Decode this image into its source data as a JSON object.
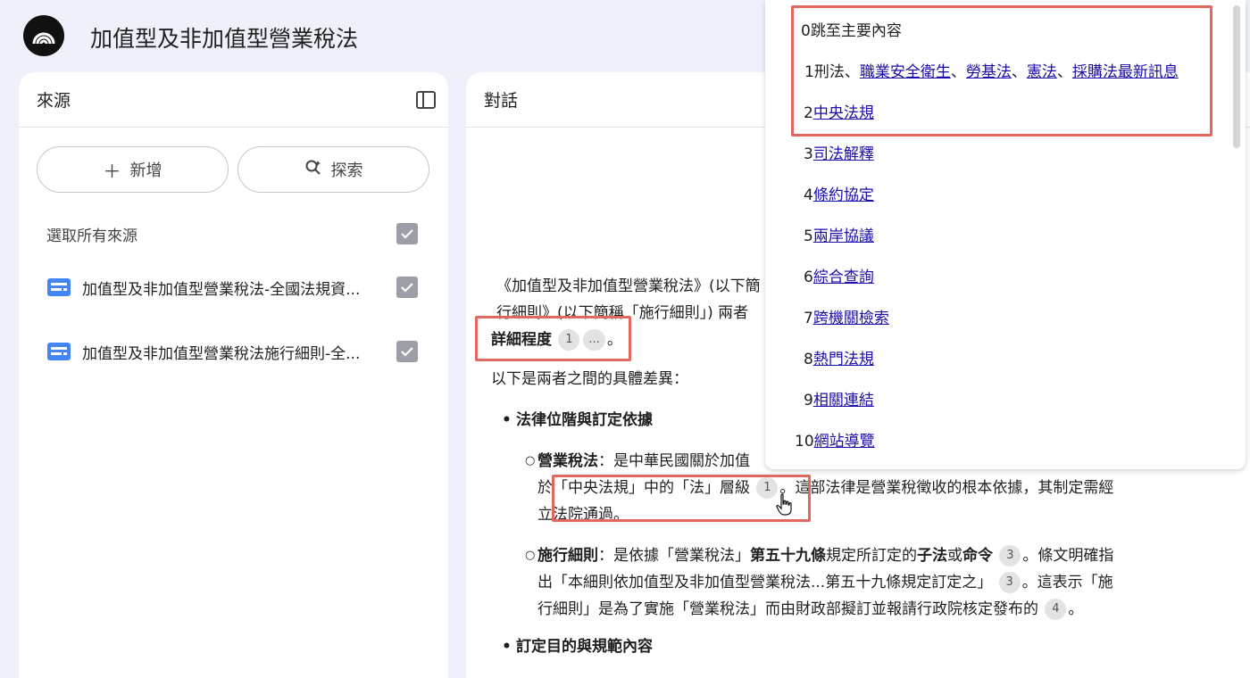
{
  "app": {
    "title": "加值型及非加值型營業稅法"
  },
  "sources_panel": {
    "title": "來源",
    "add_label": "新增",
    "explore_label": "探索",
    "select_all_label": "選取所有來源",
    "items": [
      {
        "label": "加值型及非加值型營業稅法-全國法規資..."
      },
      {
        "label": "加值型及非加值型營業稅法施行細則-全..."
      }
    ]
  },
  "chat_panel": {
    "title": "對話",
    "intro_line1": "《加值型及非加值型營業稅法》(以下簡",
    "intro_line2": "行細則》(以下簡稱「施行細則」) 兩者",
    "intro_bold": "詳細程度",
    "intro_cite1": "1",
    "intro_cite_more": "...",
    "intro_end": "。",
    "diff_intro": "以下是兩者之間的具體差異：",
    "section1_title": "法律位階與訂定依據",
    "s1_item1_bold": "營業稅法",
    "s1_item1_text_a": "：是中華民國關於加值",
    "s1_item1_text_b": "於「中央法規」中的「法」層級",
    "s1_item1_cite": "1",
    "s1_item1_text_c": "。這部法律是營業稅徵收的根本依據，其制定需經",
    "s1_item1_text_d": "立法院通過。",
    "s1_item2_bold": "施行細則",
    "s1_item2_text_a": "：是依據「營業稅法」",
    "s1_item2_bold2": "第五十九條",
    "s1_item2_text_b": "規定所訂定的",
    "s1_item2_bold3": "子法",
    "s1_item2_text_c": "或",
    "s1_item2_bold4": "命令",
    "s1_item2_cite1": "3",
    "s1_item2_text_d": "。條文明確指",
    "s1_item2_text_e": "出「本細則依加值型及非加值型營業稅法...第五十九條規定訂定之」",
    "s1_item2_cite2": "3",
    "s1_item2_text_f": "。這表示「施",
    "s1_item2_text_g": "行細則」是為了實施「營業稅法」而由財政部擬訂並報請行政院核定發布的",
    "s1_item2_cite3": "4",
    "s1_item2_text_h": "。",
    "section2_title": "訂定目的與規範內容"
  },
  "dropdown": {
    "items": [
      {
        "num": "0",
        "text": "跳至主要內容"
      },
      {
        "num": "1",
        "text": "刑法、",
        "links": [
          "職業安全衛生",
          "勞基法",
          "憲法",
          "採購法最新訊息"
        ]
      },
      {
        "num": "2",
        "link": "中央法規"
      },
      {
        "num": "3",
        "link": "司法解釋"
      },
      {
        "num": "4",
        "link": "條約協定"
      },
      {
        "num": "5",
        "link": "兩岸協議"
      },
      {
        "num": "6",
        "link": "綜合查詢"
      },
      {
        "num": "7",
        "link": "跨機關檢索"
      },
      {
        "num": "8",
        "link": "熱門法規"
      },
      {
        "num": "9",
        "link": "相關連結"
      },
      {
        "num": "10",
        "link": "網站導覽"
      }
    ],
    "sep": "、"
  },
  "colors": {
    "highlight_box": "#e0685e",
    "link": "#1a0dab",
    "background": "#eef1fa"
  }
}
